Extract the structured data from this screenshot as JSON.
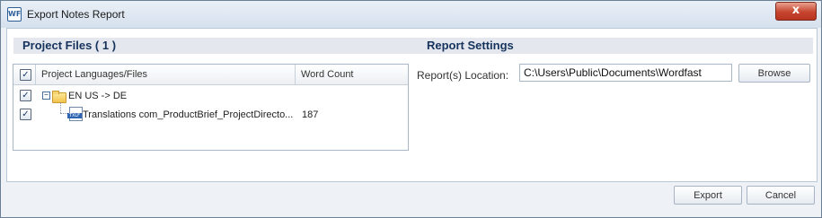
{
  "window": {
    "title": "Export Notes Report",
    "app_icon_glyph": "WF",
    "close_glyph": "x"
  },
  "project_files": {
    "header": "Project Files ( 1 )",
    "columns": [
      "Project Languages/Files",
      "Word Count"
    ],
    "rows": [
      {
        "label": "EN US -> DE",
        "word_count": "",
        "checked": true,
        "expanded": true,
        "icon": "folder-icon"
      },
      {
        "label": "Translations com_ProductBrief_ProjectDirecto...",
        "word_count": "187",
        "checked": true,
        "icon": "txlf-file-icon"
      }
    ],
    "check_glyph": "✓",
    "collapse_glyph": "−",
    "file_tag": "TXLF"
  },
  "report_settings": {
    "header": "Report Settings",
    "location_label": "Report(s) Location:",
    "location_value": "C:\\Users\\Public\\Documents\\Wordfast",
    "browse_label": "Browse"
  },
  "footer": {
    "export_label": "Export",
    "cancel_label": "Cancel"
  }
}
